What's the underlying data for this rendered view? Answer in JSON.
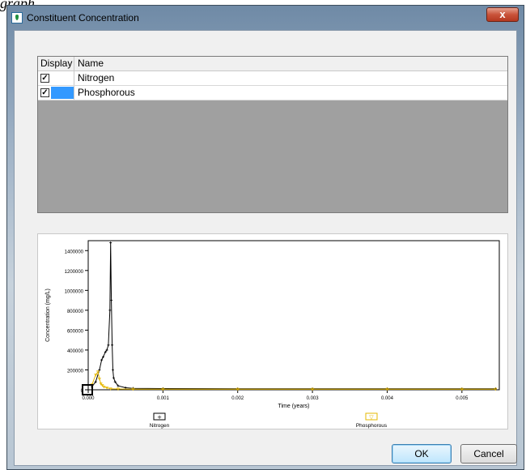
{
  "background_caption_fragment": "graph.",
  "window": {
    "title": "Constituent Concentration",
    "close_symbol": "x"
  },
  "table": {
    "headers": {
      "display": "Display",
      "name": "Name"
    },
    "rows": [
      {
        "checked": true,
        "check_mark": "✓",
        "name": "Nitrogen",
        "color": "#ffffff"
      },
      {
        "checked": true,
        "check_mark": "✓",
        "name": "Phosphorous",
        "color": "#3399ff"
      }
    ]
  },
  "chart_data": {
    "type": "line",
    "xlabel": "Time (years)",
    "ylabel": "Concentration (mg/L)",
    "xlim": [
      0,
      0.0055
    ],
    "ylim": [
      0,
      1500000
    ],
    "x_ticks": [
      "0.000",
      "0.001",
      "0.002",
      "0.003",
      "0.004",
      "0.005"
    ],
    "y_ticks": [
      "0",
      "200000",
      "400000",
      "600000",
      "800000",
      "1000000",
      "1200000",
      "1400000"
    ],
    "series": [
      {
        "name": "Nitrogen",
        "color": "#000000",
        "marker": "+",
        "x": [
          5e-05,
          0.0001,
          0.00015,
          0.00018,
          0.0002,
          0.00023,
          0.00025,
          0.00027,
          0.00029,
          0.0003,
          0.00031,
          0.00032,
          0.00033,
          0.00034,
          0.00036,
          0.0004,
          0.0005,
          0.0006,
          0.001,
          0.002,
          0.003,
          0.004,
          0.005,
          0.00545
        ],
        "y": [
          30000,
          80000,
          200000,
          300000,
          330000,
          380000,
          400000,
          450000,
          800000,
          1480000,
          900000,
          450000,
          200000,
          120000,
          80000,
          40000,
          20000,
          15000,
          12000,
          10000,
          10000,
          10000,
          10000,
          10000
        ]
      },
      {
        "name": "Phosphorous",
        "color": "#e6b800",
        "marker": "▽",
        "x": [
          5e-05,
          0.0001,
          0.00013,
          0.00015,
          0.00017,
          0.00019,
          0.00021,
          0.00025,
          0.0003,
          0.0004,
          0.0006,
          0.001,
          0.002,
          0.003,
          0.004,
          0.005,
          0.00545
        ],
        "y": [
          50000,
          150000,
          180000,
          110000,
          60000,
          45000,
          30000,
          20000,
          10000,
          8000,
          6000,
          6000,
          6000,
          6000,
          6000,
          6000,
          6000
        ]
      }
    ],
    "legend": [
      {
        "name": "Nitrogen",
        "marker": "+"
      },
      {
        "name": "Phosphorous",
        "marker": "▽"
      }
    ]
  },
  "buttons": {
    "ok": "OK",
    "cancel": "Cancel"
  }
}
